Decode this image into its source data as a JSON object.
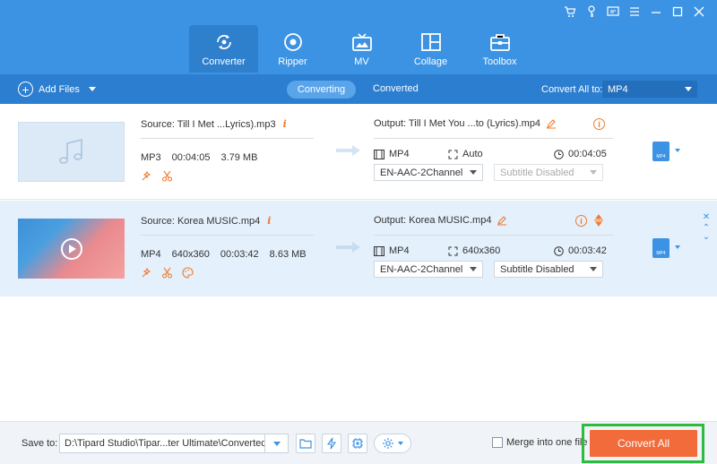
{
  "window": {
    "controls": [
      "cart-icon",
      "key-icon",
      "feedback-icon",
      "menu-icon",
      "minimize-icon",
      "maximize-icon",
      "close-icon"
    ]
  },
  "nav": {
    "items": [
      {
        "label": "Converter",
        "icon": "converter-icon",
        "active": true
      },
      {
        "label": "Ripper",
        "icon": "ripper-icon",
        "active": false
      },
      {
        "label": "MV",
        "icon": "tv-icon",
        "active": false
      },
      {
        "label": "Collage",
        "icon": "collage-icon",
        "active": false
      },
      {
        "label": "Toolbox",
        "icon": "toolbox-icon",
        "active": false
      }
    ]
  },
  "toolbar": {
    "add_files": "Add Files",
    "tab_converting": "Converting",
    "tab_converted": "Converted",
    "convert_all_to_label": "Convert All to:",
    "convert_all_to_value": "MP4"
  },
  "files": [
    {
      "source": "Source: Till I Met ...Lyrics).mp3",
      "format": "MP3",
      "duration": "00:04:05",
      "size": "3.79 MB",
      "output": "Output: Till I Met You ...to (Lyrics).mp4",
      "out_format": "MP4",
      "out_resolution": "Auto",
      "out_duration": "00:04:05",
      "audio_track": "EN-AAC-2Channel",
      "subtitle": "Subtitle Disabled",
      "format_badge": "MP4"
    },
    {
      "source": "Source: Korea MUSIC.mp4",
      "format": "MP4",
      "resolution": "640x360",
      "duration": "00:03:42",
      "size": "8.63 MB",
      "output": "Output: Korea MUSIC.mp4",
      "out_format": "MP4",
      "out_resolution": "640x360",
      "out_duration": "00:03:42",
      "audio_track": "EN-AAC-2Channel",
      "subtitle": "Subtitle Disabled",
      "format_badge": "MP4"
    }
  ],
  "bottom": {
    "save_to_label": "Save to:",
    "save_path": "D:\\Tipard Studio\\Tipar...ter Ultimate\\Converted",
    "merge_label": "Merge into one file",
    "convert_all": "Convert All",
    "highlight_color": "#2fbb3f",
    "accent_color": "#f26b3a"
  }
}
